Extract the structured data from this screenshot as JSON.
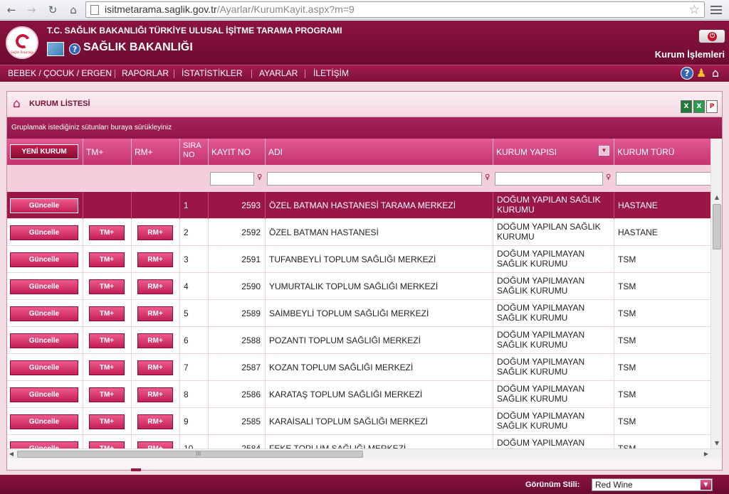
{
  "browser": {
    "url_host": "isitmetarama.saglik.gov.tr",
    "url_path": "/Ayarlar/KurumKayit.aspx?m=9"
  },
  "header": {
    "program_title": "T.C. SAĞLIK BAKANLIĞI TÜRKİYE ULUSAL İŞİTME TARAMA PROGRAMI",
    "ministry_title": "SAĞLIK BAKANLIĞI",
    "section_title": "Kurum İşlemleri",
    "logo_text": "Sağlık Bakanlığı"
  },
  "menu": [
    "BEBEK / ÇOCUK / ERGEN",
    "RAPORLAR",
    "İSTATİSTİKLER",
    "AYARLAR",
    "İLETİŞİM"
  ],
  "panel": {
    "title": "KURUM LİSTESİ",
    "group_hint": "Gruplamak istediğiniz sütunları buraya sürükleyiniz"
  },
  "grid": {
    "new_button": "YENİ KURUM",
    "columns": {
      "tm": "TM+",
      "rm": "RM+",
      "sira_1": "SIRA",
      "sira_2": "NO",
      "kayit": "KAYIT NO",
      "adi": "ADI",
      "yapi": "KURUM YAPISI",
      "tur": "KURUM TÜRÜ"
    },
    "update_label": "Güncelle",
    "tm_label": "TM+",
    "rm_label": "RM+",
    "rows": [
      {
        "sira": "1",
        "kayit": "2593",
        "adi": "ÖZEL BATMAN HASTANESİ TARAMA MERKEZİ",
        "yapi": "DOĞUM YAPILAN SAĞLIK KURUMU",
        "tur": "HASTANE"
      },
      {
        "sira": "2",
        "kayit": "2592",
        "adi": "ÖZEL BATMAN HASTANESİ",
        "yapi": "DOĞUM YAPILAN SAĞLIK KURUMU",
        "tur": "HASTANE"
      },
      {
        "sira": "3",
        "kayit": "2591",
        "adi": "TUFANBEYLİ TOPLUM SAĞLIĞI MERKEZİ",
        "yapi": "DOĞUM YAPILMAYAN SAĞLIK KURUMU",
        "tur": "TSM"
      },
      {
        "sira": "4",
        "kayit": "2590",
        "adi": "YUMURTALIK TOPLUM SAĞLIĞI MERKEZİ",
        "yapi": "DOĞUM YAPILMAYAN SAĞLIK KURUMU",
        "tur": "TSM"
      },
      {
        "sira": "5",
        "kayit": "2589",
        "adi": "SAİMBEYLİ TOPLUM SAĞLIĞI MERKEZİ",
        "yapi": "DOĞUM YAPILMAYAN SAĞLIK KURUMU",
        "tur": "TSM"
      },
      {
        "sira": "6",
        "kayit": "2588",
        "adi": "POZANTI TOPLUM SAĞLIĞI MERKEZİ",
        "yapi": "DOĞUM YAPILMAYAN SAĞLIK KURUMU",
        "tur": "TSM"
      },
      {
        "sira": "7",
        "kayit": "2587",
        "adi": "KOZAN TOPLUM SAĞLIĞI MERKEZİ",
        "yapi": "DOĞUM YAPILMAYAN SAĞLIK KURUMU",
        "tur": "TSM"
      },
      {
        "sira": "8",
        "kayit": "2586",
        "adi": "KARATAŞ TOPLUM SAĞLIĞI MERKEZİ",
        "yapi": "DOĞUM YAPILMAYAN SAĞLIK KURUMU",
        "tur": "TSM"
      },
      {
        "sira": "9",
        "kayit": "2585",
        "adi": "KARAİSALI TOPLUM SAĞLIĞI MERKEZİ",
        "yapi": "DOĞUM YAPILMAYAN SAĞLIK KURUMU",
        "tur": "TSM"
      },
      {
        "sira": "10",
        "kayit": "2584",
        "adi": "FEKE TOPLUM SAĞLIĞI MERKEZİ",
        "yapi": "DOĞUM YAPILMAYAN SAĞLIK KURUMU",
        "tur": "TSM"
      }
    ]
  },
  "footer": {
    "style_label": "Görünüm Stili:",
    "style_value": "Red Wine"
  },
  "colors": {
    "brand": "#8b1340",
    "accent": "#c5336f",
    "selected_row": "#9a1647"
  }
}
